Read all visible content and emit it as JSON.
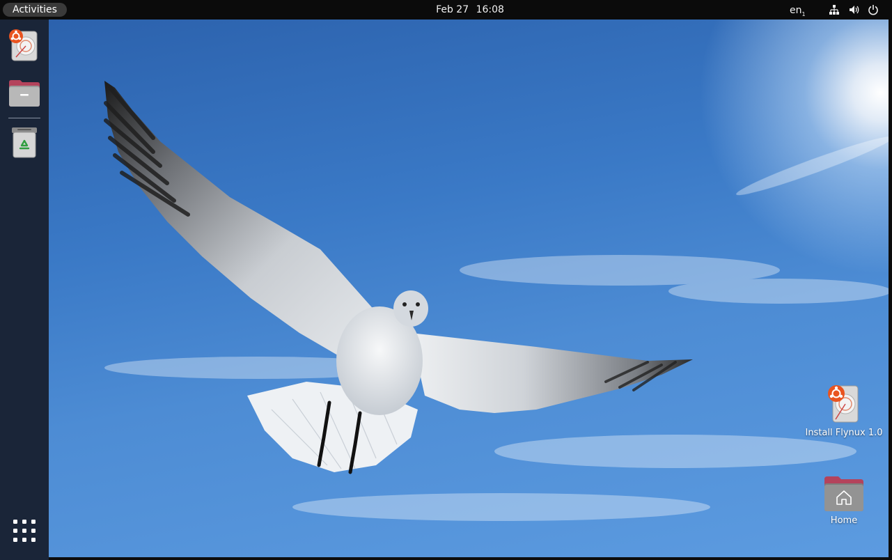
{
  "topbar": {
    "activities_label": "Activities",
    "date": "Feb 27",
    "time": "16:08",
    "input_source": "en",
    "input_source_sub": "1",
    "tray_icons": [
      "network-icon",
      "volume-icon",
      "power-icon"
    ]
  },
  "dock": {
    "items": [
      {
        "name": "Install Flynux",
        "icon": "installer-icon"
      },
      {
        "name": "Files",
        "icon": "files-icon"
      },
      {
        "name": "Trash",
        "icon": "trash-icon"
      }
    ],
    "show_apps_icon": "app-grid-icon"
  },
  "desktop": {
    "icons": [
      {
        "label": "Install Flynux 1.0",
        "icon": "installer-icon"
      },
      {
        "label": "Home",
        "icon": "home-folder-icon"
      }
    ]
  },
  "colors": {
    "topbar_bg": "#0b0b0b",
    "dock_bg": "#1a2538",
    "sky_top": "#2c62ad",
    "sky_bottom": "#5c9be0",
    "accent_orange": "#e95420"
  }
}
